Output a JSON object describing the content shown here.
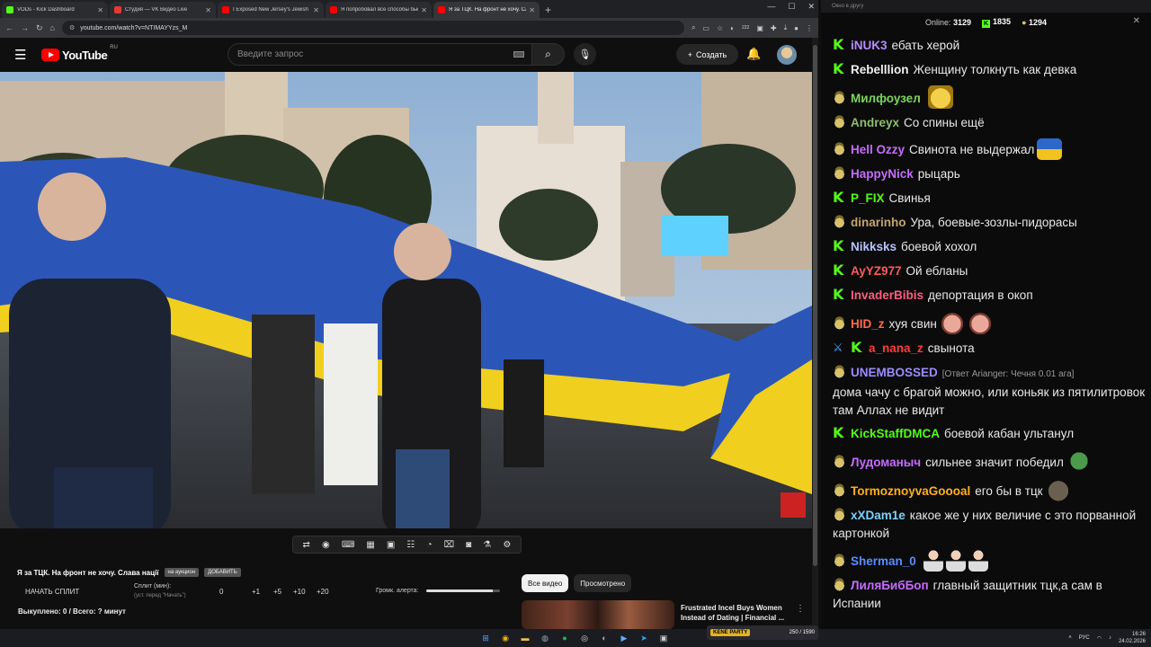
{
  "browser": {
    "tabs": [
      {
        "label": "VODs - Kick Dashboard",
        "color": "#53fc18"
      },
      {
        "label": "Студия — VK Видео Live",
        "color": "#e53935"
      },
      {
        "label": "I Exposed New Jersey's Jewish Stre...",
        "color": "#ff0000"
      },
      {
        "label": "Я попробовал все способы быстро...",
        "color": "#ff0000"
      },
      {
        "label": "Я за ТЦК. На фронт не хочу. Сла...",
        "color": "#ff0000",
        "active": true
      }
    ],
    "url": "youtube.com/watch?v=NTIMAYYzs_M",
    "ext_badge": "222"
  },
  "youtube": {
    "logo": "YouTube",
    "region": "RU",
    "search_placeholder": "Введите запрос",
    "create_label": "Создать",
    "video": {
      "title": "Я за ТЦК. На фронт не хочу. Слава нації",
      "tag1": "на аукцион",
      "tag2": "ДОБАВИТЬ"
    },
    "split": {
      "start_label": "НАЧАТЬ СПЛИТ",
      "label": "Сплит (мин):",
      "hint": "(уст. перед \"Начать\")",
      "values": [
        "0",
        "+1",
        "+5",
        "+10",
        "+20"
      ]
    },
    "alert_label": "Громк. алерта:",
    "alert_volume": 0.9,
    "spent": "Выкуплено: 0 / Всего: ? минут",
    "filter_chips": [
      {
        "label": "Все видео",
        "selected": true
      },
      {
        "label": "Просмотрено",
        "selected": false
      }
    ],
    "recommendation": {
      "title": "Frustrated Incel Buys Women Instead of Dating | Financial ..."
    }
  },
  "chat": {
    "window_title": "Окно в другу",
    "online_label": "Online:",
    "online_count": "3129",
    "kick_count": "1835",
    "other_count": "1294",
    "messages": [
      {
        "badge": "kick",
        "user": "iNUK3",
        "color": "#b98cff",
        "text": "ебать херой",
        "emote": ""
      },
      {
        "badge": "kick",
        "user": "Rebelllion",
        "color": "#f0f0f0",
        "text": "Женщину толкнуть как девка",
        "emote": ""
      },
      {
        "badge": "pepe",
        "user": "Милфоузел",
        "color": "#7cd65a",
        "text": "",
        "emote": "jester"
      },
      {
        "badge": "pepe",
        "user": "Andreyx",
        "color": "#8fbf6a",
        "text": "Со спины ещё",
        "emote": ""
      },
      {
        "badge": "pepe",
        "user": "Hell Ozzy",
        "color": "#c86bff",
        "text": "Свинота не выдержал",
        "emote": "flag"
      },
      {
        "badge": "pepe",
        "user": "HappyNick",
        "color": "#c86bff",
        "text": "рыцарь",
        "emote": ""
      },
      {
        "badge": "kick",
        "user": "P_FIX",
        "color": "#53fc18",
        "text": "Свинья",
        "emote": ""
      },
      {
        "badge": "pepe",
        "user": "dinarinho",
        "color": "#c5a56a",
        "text": "Ура, боевые-зозлы-пидорасы",
        "emote": ""
      },
      {
        "badge": "kick",
        "user": "Nikksks",
        "color": "#b7c4ff",
        "text": "боевой хохол",
        "emote": ""
      },
      {
        "badge": "kick",
        "user": "AyYZ977",
        "color": "#ff5a5a",
        "text": "Ой ебланы",
        "emote": ""
      },
      {
        "badge": "kick",
        "user": "InvaderBibis",
        "color": "#ff5e7e",
        "text": "депортация в окоп",
        "emote": ""
      },
      {
        "badge": "pepe",
        "user": "HID_z",
        "color": "#ff6a4a",
        "text": "хуя свин",
        "emote": "pig2"
      },
      {
        "badge": "sword-kick",
        "user": "a_nana_z",
        "color": "#ff3a3a",
        "text": "свынота",
        "emote": ""
      },
      {
        "badge": "pepe",
        "user": "UNEMBOSSED",
        "color": "#9b8cff",
        "reply": "[Ответ Arianger: Чечня 0.01 ага]",
        "text": "дома чачу с брагой можно, или коньяк из пятилитровок там Аллах не видит",
        "emote": ""
      },
      {
        "badge": "kick",
        "user": "KickStaffDMCA",
        "color": "#53fc18",
        "text": "боевой кабан ультанул",
        "emote": ""
      },
      {
        "badge": "pepe",
        "user": "Лудоманыч",
        "color": "#c86bff",
        "text": "сильнее значит победил",
        "emote": "frog"
      },
      {
        "badge": "pepe",
        "user": "TormoznoyvaGoooal",
        "color": "#ffb020",
        "text": "его бы в тцк",
        "emote": "boar"
      },
      {
        "badge": "pepe",
        "user": "xXDam1e",
        "color": "#7ad1ff",
        "text": "какое же у них величие с это порванной картонкой",
        "emote": ""
      },
      {
        "badge": "pepe",
        "user": "Sherman_0",
        "color": "#5a8cff",
        "text": "",
        "emote": "man3"
      },
      {
        "badge": "pepe",
        "user": "ЛиляБибБоп",
        "color": "#c86bff",
        "text": "главный защитник тцк,а сам в Испании",
        "emote": ""
      }
    ]
  },
  "taskbar": {
    "widget_text": "250 / 1590",
    "widget_brand": "KENE PARTY",
    "lang": "РУС",
    "time": "16:26",
    "date": "24.02.2026"
  }
}
